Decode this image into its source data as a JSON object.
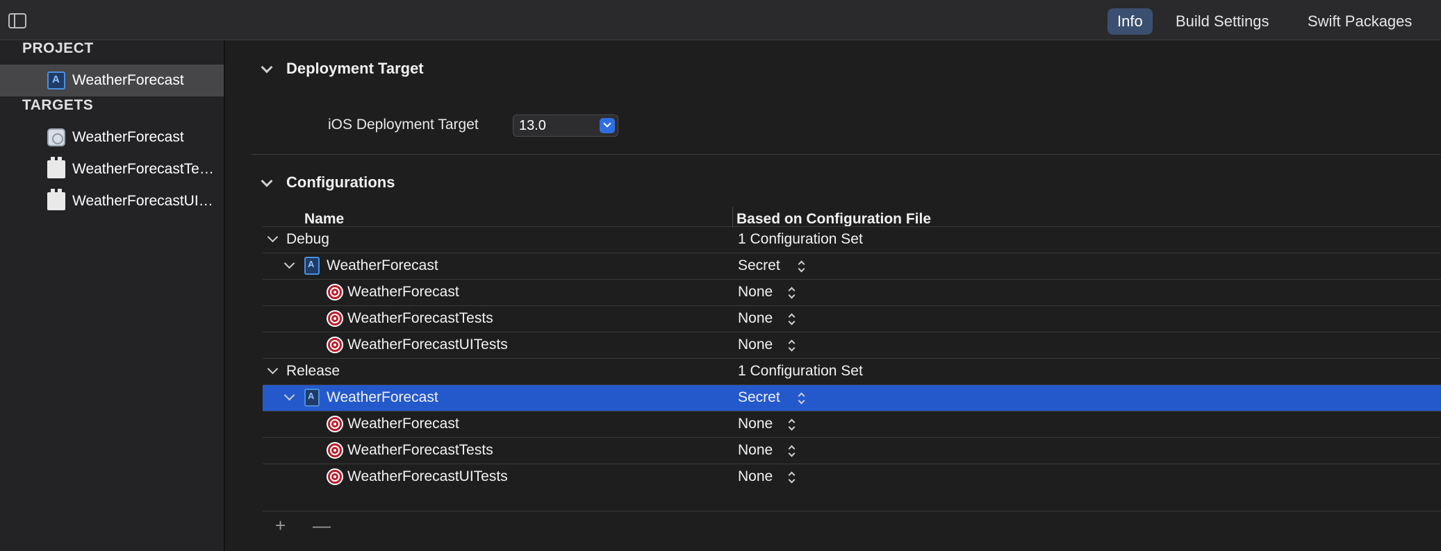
{
  "toolbar": {
    "tabs": [
      {
        "label": "Info",
        "active": true
      },
      {
        "label": "Build Settings",
        "active": false
      },
      {
        "label": "Swift Packages",
        "active": false
      }
    ]
  },
  "sidebar": {
    "project_header": "PROJECT",
    "project_item": "WeatherForecast",
    "targets_header": "TARGETS",
    "targets": [
      {
        "label": "WeatherForecast",
        "icon": "app-icon"
      },
      {
        "label": "WeatherForecastTests",
        "icon": "bundle-icon"
      },
      {
        "label": "WeatherForecastUITests",
        "icon": "bundle-icon"
      }
    ]
  },
  "deployment": {
    "title": "Deployment Target",
    "label": "iOS Deployment Target",
    "value": "13.0"
  },
  "configurations": {
    "title": "Configurations",
    "columns": [
      "Name",
      "Based on Configuration File"
    ],
    "rows": [
      {
        "name": "Debug",
        "value": "1 Configuration Set",
        "level": 0
      },
      {
        "name": "WeatherForecast",
        "value": "Secret",
        "level": 1,
        "icon": "project-icon"
      },
      {
        "name": "WeatherForecast",
        "value": "None",
        "level": 2,
        "icon": "target-icon"
      },
      {
        "name": "WeatherForecastTests",
        "value": "None",
        "level": 2,
        "icon": "target-icon"
      },
      {
        "name": "WeatherForecastUITests",
        "value": "None",
        "level": 2,
        "icon": "target-icon"
      },
      {
        "name": "Release",
        "value": "1 Configuration Set",
        "level": 0
      },
      {
        "name": "WeatherForecast",
        "value": "Secret",
        "level": 1,
        "icon": "project-icon",
        "selected": true
      },
      {
        "name": "WeatherForecast",
        "value": "None",
        "level": 2,
        "icon": "target-icon"
      },
      {
        "name": "WeatherForecastTests",
        "value": "None",
        "level": 2,
        "icon": "target-icon"
      },
      {
        "name": "WeatherForecastUITests",
        "value": "None",
        "level": 2,
        "icon": "target-icon"
      }
    ],
    "add_label": "+",
    "remove_label": "—"
  },
  "colors": {
    "selection": "#2459cc",
    "active_tab": "#3b4f70",
    "target_icon": "#b81d2c"
  }
}
